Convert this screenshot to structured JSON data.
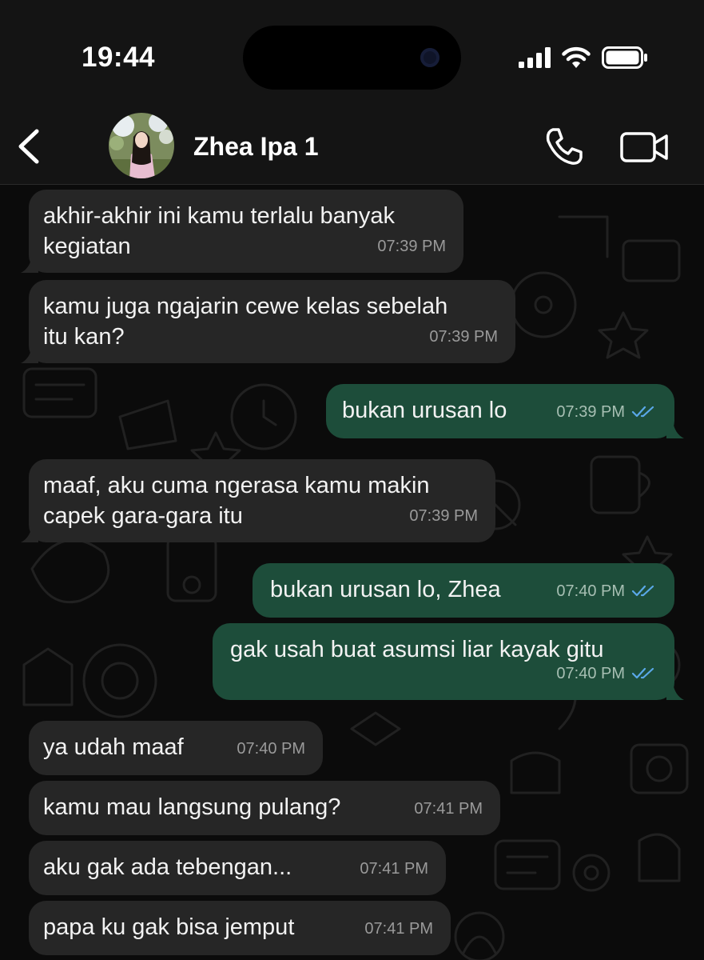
{
  "status_bar": {
    "time": "19:44"
  },
  "header": {
    "contact_name": "Zhea Ipa 1"
  },
  "messages": [
    {
      "dir": "in",
      "text": "akhir-akhir ini kamu terlalu banyak\nkegiatan",
      "time": "07:39 PM"
    },
    {
      "dir": "in",
      "text": "kamu juga ngajarin cewe kelas sebelah\nitu kan?",
      "time": "07:39 PM"
    },
    {
      "dir": "out",
      "text": "bukan urusan lo",
      "time": "07:39 PM"
    },
    {
      "dir": "in",
      "text": "maaf, aku cuma ngerasa kamu makin\ncapek gara-gara itu",
      "time": "07:39 PM"
    },
    {
      "dir": "out",
      "text": "bukan urusan lo, Zhea",
      "time": "07:40 PM"
    },
    {
      "dir": "out",
      "text": "gak usah buat asumsi liar kayak gitu",
      "time": "07:40 PM"
    },
    {
      "dir": "in",
      "text": "ya udah maaf",
      "time": "07:40 PM"
    },
    {
      "dir": "in",
      "text": "kamu mau langsung pulang?",
      "time": "07:41 PM"
    },
    {
      "dir": "in",
      "text": "aku gak ada tebengan...",
      "time": "07:41 PM"
    },
    {
      "dir": "in",
      "text": "papa ku gak bisa jemput",
      "time": "07:41 PM"
    }
  ],
  "colors": {
    "incoming_bubble": "#262626",
    "outgoing_bubble": "#1d4d3a",
    "read_tick": "#5aa8e8",
    "background": "#0b0b0b"
  },
  "icons": [
    "signal-icon",
    "wifi-icon",
    "battery-icon",
    "back-chevron-icon",
    "phone-icon",
    "video-camera-icon",
    "double-check-icon"
  ]
}
